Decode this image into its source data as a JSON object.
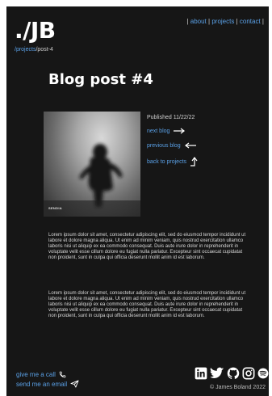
{
  "header": {
    "logo": "./JB",
    "nav": {
      "open": "|",
      "about": "about",
      "sep1": "|",
      "projects": "projects",
      "sep2": "|",
      "contact": "contact",
      "close": "|"
    }
  },
  "breadcrumb": {
    "parent": "/projects",
    "current": "/post-4"
  },
  "post": {
    "title": "Blog post #4",
    "cover_label": "SENDIA",
    "published": "Published 11/22/22",
    "links": {
      "next": "next blog",
      "previous": "previous blog",
      "back": "back to projects"
    },
    "paragraphs": [
      "Lorem ipsum dolor sit amet, consectetur adipiscing elit, sed do eiusmod tempor incididunt ut labore et dolore magna aliqua. Ut enim ad minim veniam, quis nostrud exercitation ullamco laboris nisi ut aliquip ex ea commodo consequat. Duis aute irure dolor in reprehenderit in voluptate velit esse cillum dolore eu fugiat nulla pariatur. Excepteur sint occaecat cupidatat non proident, sunt in culpa qui officia deserunt mollit anim id est laborum.",
      "Lorem ipsum dolor sit amet, consectetur adipiscing elit, sed do eiusmod tempor incididunt ut labore et dolore magna aliqua. Ut enim ad minim veniam, quis nostrud exercitation ullamco laboris nisi ut aliquip ex ea commodo consequat. Duis aute irure dolor in reprehenderit in voluptate velit esse cillum dolore eu fugiat nulla pariatur. Excepteur sint occaecat cupidatat non proident, sunt in culpa qui officia deserunt mollit anim id est laborum."
    ]
  },
  "footer": {
    "call": "give me a call",
    "email": "send me an email",
    "copyright": "© James Boland 2022",
    "social_icons": [
      "linkedin-icon",
      "twitter-icon",
      "github-icon",
      "instagram-icon",
      "spotify-icon"
    ]
  },
  "colors": {
    "background": "#161616",
    "link": "#5aa0e6",
    "text": "#dcdcdc"
  }
}
